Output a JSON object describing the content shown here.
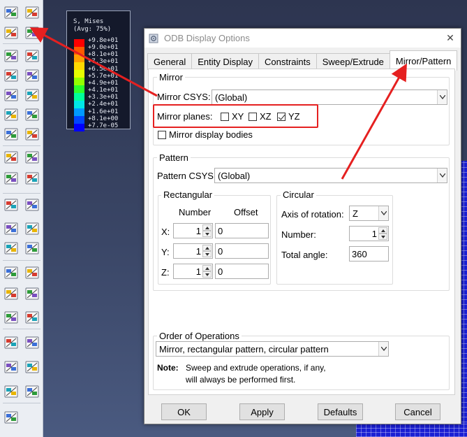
{
  "legend": {
    "title_line1": "S, Mises",
    "title_line2": "(Avg: 75%)",
    "values": [
      "+9.8e+01",
      "+9.0e+01",
      "+8.1e+01",
      "+7.3e+01",
      "+6.5e+01",
      "+5.7e+01",
      "+4.9e+01",
      "+4.1e+01",
      "+3.3e+01",
      "+2.4e+01",
      "+1.6e+01",
      "+8.1e+00",
      "+7.7e-05"
    ],
    "colors": [
      "#ff0000",
      "#ff5a00",
      "#ff9f00",
      "#ffd800",
      "#e6ff00",
      "#94ff00",
      "#2dff2d",
      "#00ff9a",
      "#00e6e6",
      "#0099ff",
      "#0046ff",
      "#0000ff"
    ]
  },
  "toolbar": {
    "icons": [
      [
        "numbered-nodes-icon",
        "numbered-elements-icon"
      ],
      [
        "mirror-pattern-icon",
        "layer-stack-icon"
      ],
      [
        "plot-undeformed-icon",
        "plot-deformed-icon"
      ],
      [
        "plot-contours-icon",
        "contour-options-icon"
      ],
      [
        "plot-symbols-icon",
        "symbol-options-icon"
      ],
      [
        "plot-material-orientation-icon",
        "orientation-options-icon"
      ],
      [
        "allow-multiple-plot-states-icon",
        "superimpose-options-icon"
      ],
      [
        "animate-scale-factor-icon",
        "animate-time-history-icon"
      ],
      [
        "animate-harmonic-icon",
        "animation-options-icon"
      ],
      [
        "view-cut-icon",
        "view-cut-manager-icon"
      ],
      [
        "xy-data-icon",
        "xy-data-manager-icon"
      ],
      [
        "path-icon",
        "path-plot-icon"
      ],
      [
        "free-body-icon",
        "free-body-manager-icon"
      ],
      [
        "stream-icon",
        "stream-manager-icon"
      ],
      [
        "probe-values-icon",
        "query-manager-icon"
      ],
      [
        "display-group-icon",
        "display-group-manager-icon"
      ],
      [
        "tubes-icon",
        "tube-options-icon"
      ],
      [
        "transform-icon",
        "transform-manager-icon"
      ],
      [
        "edit-pen-icon"
      ]
    ]
  },
  "dialog": {
    "title": "ODB Display Options",
    "close_glyph": "✕",
    "tabs": [
      "General",
      "Entity Display",
      "Constraints",
      "Sweep/Extrude",
      "Mirror/Pattern"
    ],
    "active_tab": "Mirror/Pattern",
    "mirror": {
      "label": "Mirror",
      "csys_label": "Mirror CSYS:",
      "csys_value": "(Global)",
      "planes_label": "Mirror planes:",
      "planes": [
        {
          "name": "XY",
          "checked": false
        },
        {
          "name": "XZ",
          "checked": false
        },
        {
          "name": "YZ",
          "checked": true
        }
      ],
      "display_bodies_label": "Mirror display bodies",
      "display_bodies_checked": false
    },
    "pattern": {
      "label": "Pattern",
      "csys_label": "Pattern CSYS:",
      "csys_value": "(Global)",
      "rectangular": {
        "label": "Rectangular",
        "col_number": "Number",
        "col_offset": "Offset",
        "rows": [
          {
            "axis": "X:",
            "number": "1",
            "offset": "0"
          },
          {
            "axis": "Y:",
            "number": "1",
            "offset": "0"
          },
          {
            "axis": "Z:",
            "number": "1",
            "offset": "0"
          }
        ]
      },
      "circular": {
        "label": "Circular",
        "axis_label": "Axis of rotation:",
        "axis_value": "Z",
        "number_label": "Number:",
        "number_value": "1",
        "angle_label": "Total angle:",
        "angle_value": "360"
      }
    },
    "order": {
      "label": "Order of Operations",
      "value": "Mirror, rectangular pattern, circular pattern",
      "note_title": "Note:",
      "note_line1": "Sweep and extrude operations, if any,",
      "note_line2": "will always be performed first."
    },
    "buttons": {
      "ok": "OK",
      "apply": "Apply",
      "defaults": "Defaults",
      "cancel": "Cancel"
    }
  },
  "annotation_color": "#e52020"
}
